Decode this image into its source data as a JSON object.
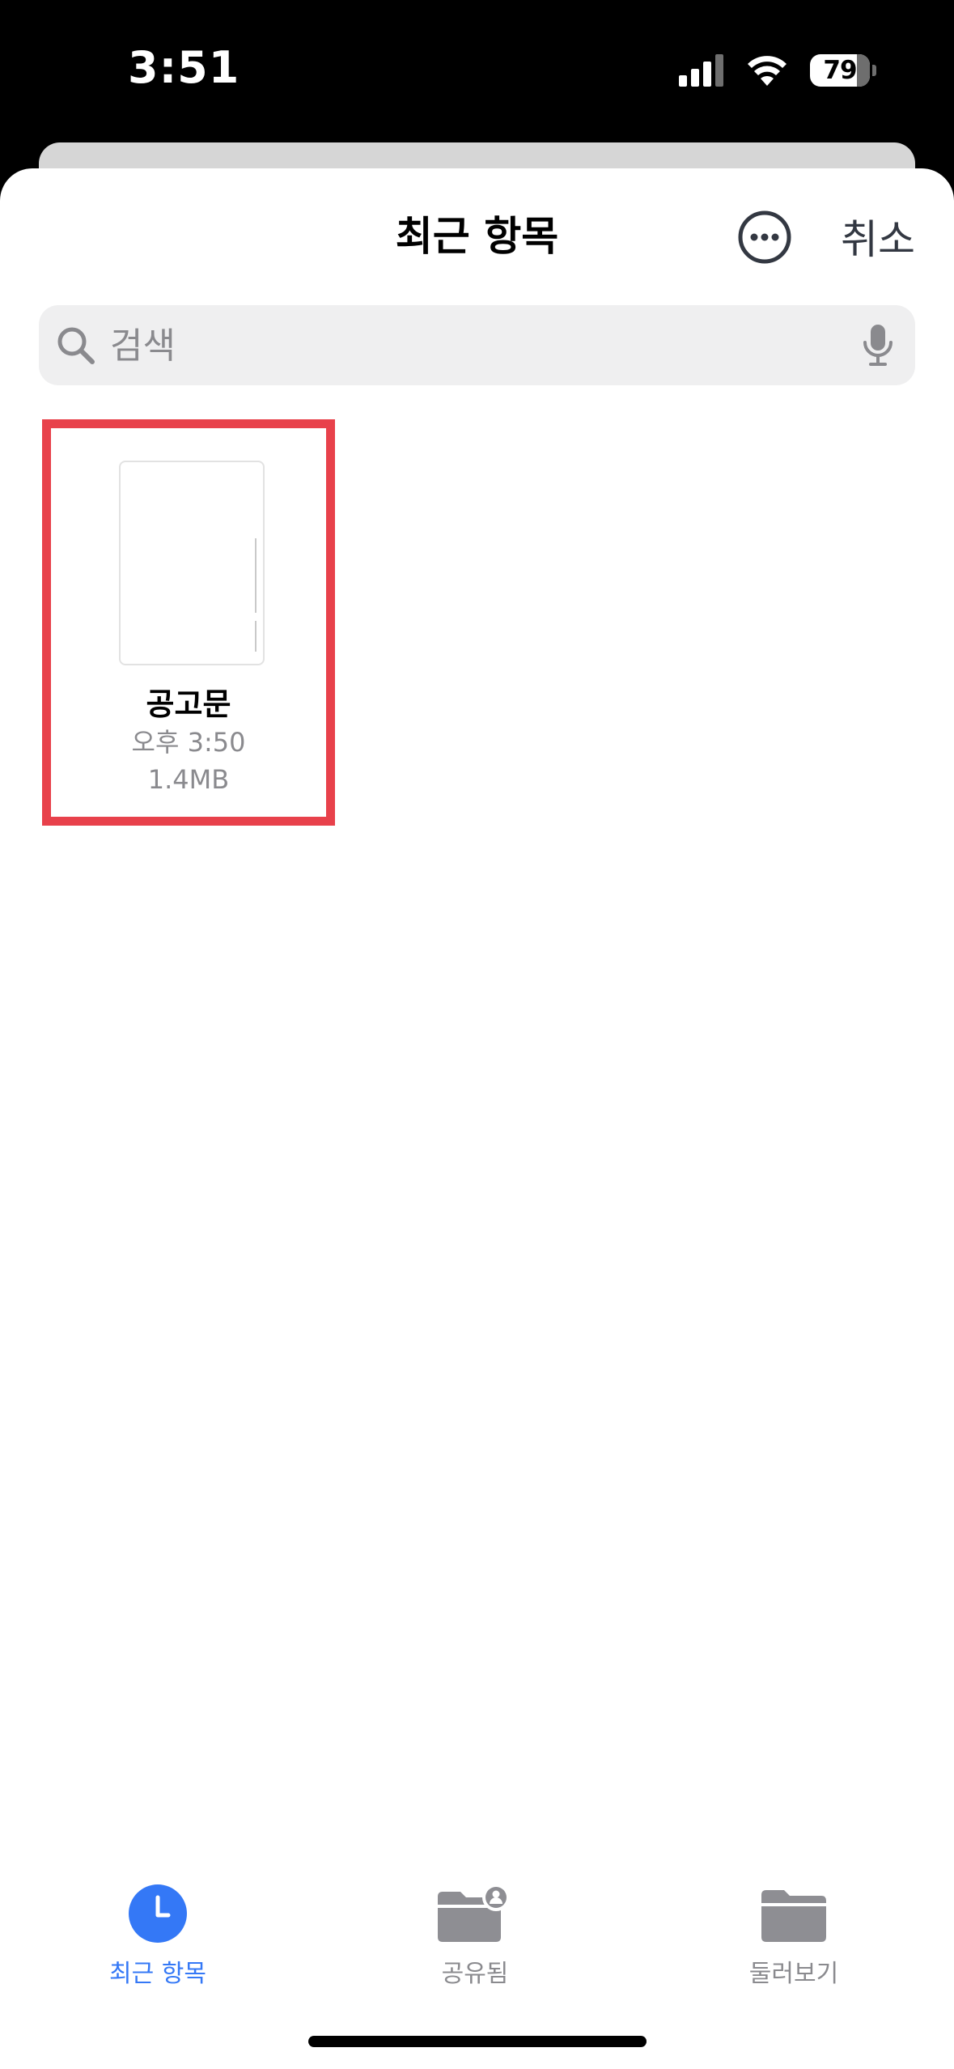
{
  "status_bar": {
    "time": "3:51",
    "battery": "79",
    "icons": [
      "cellular-signal-icon",
      "wifi-icon",
      "battery-icon"
    ]
  },
  "header": {
    "title": "최근 항목",
    "more_icon": "ellipsis-circle-icon",
    "cancel_label": "취소"
  },
  "search": {
    "placeholder": "검색",
    "icons": [
      "search-icon",
      "microphone-icon"
    ]
  },
  "files": [
    {
      "name": "공고문",
      "time": "오후 3:50",
      "size": "1.4MB",
      "selected": true,
      "highlight_color": "#e8414b"
    }
  ],
  "tabbar": {
    "tabs": [
      {
        "label": "최근 항목",
        "icon": "clock-icon",
        "active": true
      },
      {
        "label": "공유됨",
        "icon": "shared-folder-icon",
        "active": false
      },
      {
        "label": "둘러보기",
        "icon": "folder-icon",
        "active": false
      }
    ],
    "active_color": "#3478f6",
    "inactive_color": "#8a8a8e"
  }
}
